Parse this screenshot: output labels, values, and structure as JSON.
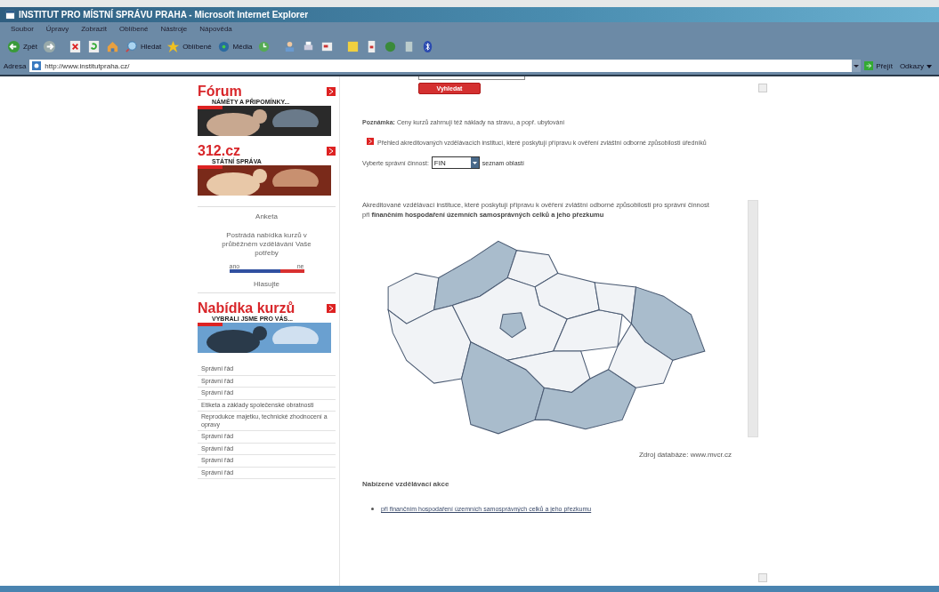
{
  "window": {
    "title": "INSTITUT PRO MÍSTNÍ SPRÁVU PRAHA - Microsoft Internet Explorer"
  },
  "menu": [
    "Soubor",
    "Úpravy",
    "Zobrazit",
    "Oblíbené",
    "Nástroje",
    "Nápověda"
  ],
  "toolbar": {
    "back": "Zpět",
    "search": "Hledat",
    "favorites": "Oblíbené",
    "media": "Média"
  },
  "address_bar": {
    "label": "Adresa",
    "value": "http://www.institutpraha.cz/",
    "go": "Přejít",
    "links": "Odkazy"
  },
  "sidebar": {
    "banners": [
      {
        "title": "Fórum",
        "subtitle": "NÁMĚTY A PŘIPOMÍNKY..."
      },
      {
        "title": "312.cz",
        "subtitle": "STÁTNÍ SPRÁVA"
      },
      {
        "title": "Nabídka kurzů",
        "subtitle": "VYBRALI JSME PRO VÁS..."
      }
    ],
    "poll": {
      "title": "Anketa",
      "question": "Postrádá nabídka kurzů v průběžném vzdělávání Vaše potřeby",
      "left_label": "ano",
      "right_label": "ne",
      "level": 0.68,
      "vote": "Hlasujte"
    },
    "course_links": [
      "Správní řád",
      "Správní řád",
      "Správní řád",
      "Etiketa a základy společenské obratnosti",
      "Reprodukce majetku, technické zhodnocení a opravy",
      "Správní řád",
      "Správní řád",
      "Správní řád",
      "Správní řád"
    ]
  },
  "main": {
    "search_button": "Vyhledat",
    "note": "**Poznámka:** Ceny kurzů zahrnují též náklady na stravu, a popř. ubytování",
    "overview_link": "Přehled akreditovaných vzdělávacích institucí, které poskytují přípravu k ověření zvláštní odborné způsobilosti úředníků",
    "activity": {
      "label": "Vyberte správní činnost:",
      "value": "FIN",
      "link": "seznam oblastí"
    },
    "description": "Akreditované vzdělávací instituce, které poskytují přípravu k ověření zvláštní odborné způsobilosti pro správní činnost při **finančním hospodaření územních samosprávných celků a jeho přezkumu**",
    "map_regions": [
      {
        "highlighted": false
      },
      {
        "highlighted": true
      },
      {
        "highlighted": false
      },
      {
        "highlighted": false
      },
      {
        "highlighted": false
      },
      {
        "highlighted": false
      },
      {
        "highlighted": true
      },
      {
        "highlighted": false
      },
      {
        "highlighted": false
      },
      {
        "highlighted": true
      },
      {
        "highlighted": true
      },
      {
        "highlighted": false
      },
      {
        "highlighted": true
      },
      {
        "highlighted": false
      }
    ],
    "source": "Zdroj databáze: www.mvcr.cz",
    "offers_heading": "Nabízené vzdělávací akce",
    "offers": [
      "při finančním hospodaření územních samosprávných celků a jeho přezkumu"
    ]
  }
}
